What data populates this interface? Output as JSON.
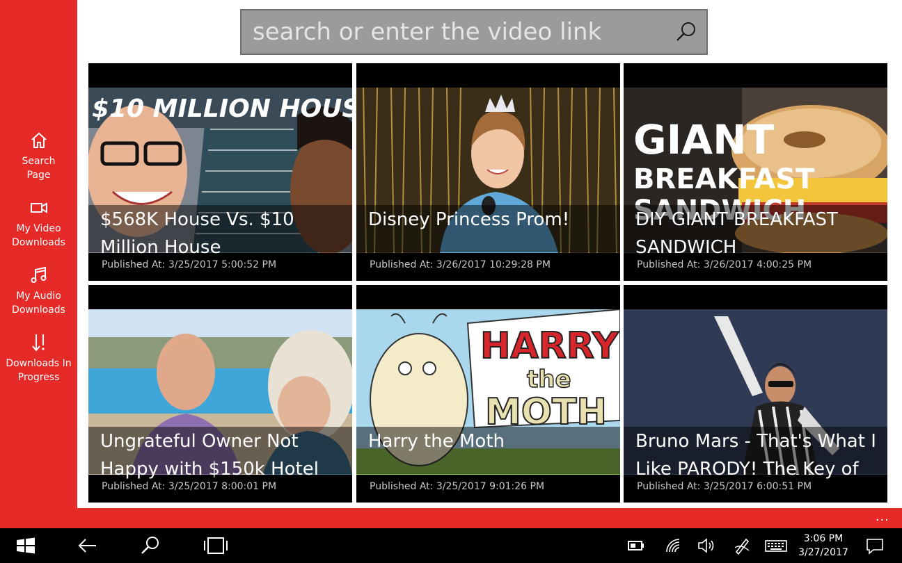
{
  "search": {
    "placeholder": "search or enter the video link",
    "icon": "search-icon"
  },
  "sidebar": {
    "items": [
      {
        "label": "Search Page",
        "icon": "home-icon"
      },
      {
        "label": "My Video Downloads",
        "icon": "video-camera-icon"
      },
      {
        "label": "My Audio Downloads",
        "icon": "music-note-icon"
      },
      {
        "label": "Downloads In Progress",
        "icon": "download-arrows-icon"
      }
    ]
  },
  "videos": [
    {
      "title": "$568K House Vs. $10 Million House",
      "published_label": "Published At:",
      "published": "3/25/2017 5:00:52 PM",
      "thumb_text": "$10 MILLION HOUS"
    },
    {
      "title": "Disney Princess Prom!",
      "published_label": "Published At:",
      "published": "3/26/2017 10:29:28 PM"
    },
    {
      "title": "DIY GIANT BREAKFAST SANDWICH",
      "published_label": "Published At:",
      "published": "3/26/2017 4:00:25 PM",
      "thumb_text": [
        "GIANT",
        "BREAKFAST",
        "SANDWICH"
      ]
    },
    {
      "title": "Ungrateful Owner Not Happy with $150k Hotel",
      "published_label": "Published At:",
      "published": "3/25/2017 8:00:01 PM"
    },
    {
      "title": "Harry the Moth",
      "published_label": "Published At:",
      "published": "3/25/2017 9:01:26 PM",
      "thumb_text": [
        "HARRY",
        "the",
        "MOTH"
      ]
    },
    {
      "title": "Bruno Mars - That's What I Like PARODY! The Key of",
      "published_label": "Published At:",
      "published": "3/25/2017 6:00:51 PM"
    }
  ],
  "appbar": {
    "more_label": "..."
  },
  "taskbar": {
    "time": "3:06 PM",
    "date": "3/27/2017",
    "icons": [
      "windows-start-icon",
      "back-arrow-icon",
      "search-icon",
      "task-view-icon",
      "battery-icon",
      "wifi-icon",
      "volume-icon",
      "pen-icon",
      "keyboard-icon",
      "notification-icon"
    ]
  },
  "colors": {
    "accent": "#e52a27",
    "search_bg": "#9b9b9b",
    "taskbar_bg": "#000000"
  }
}
